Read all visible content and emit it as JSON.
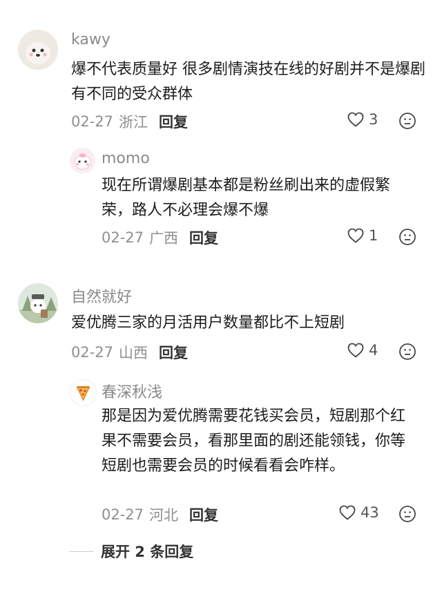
{
  "comments": [
    {
      "username": "kawy",
      "text": "爆不代表质量好 很多剧情演技在线的好剧并不是爆剧 有不同的受众群体",
      "date": "02-27",
      "location": "浙江",
      "reply_label": "回复",
      "likes": "3"
    },
    {
      "username": "momo",
      "text": "现在所谓爆剧基本都是粉丝刷出来的虚假繁荣，路人不必理会爆不爆",
      "date": "02-27",
      "location": "广西",
      "reply_label": "回复",
      "likes": "1"
    },
    {
      "username": "自然就好",
      "text": "爱优腾三家的月活用户数量都比不上短剧",
      "date": "02-27",
      "location": "山西",
      "reply_label": "回复",
      "likes": "4"
    },
    {
      "username": "春深秋浅",
      "text": "那是因为爱优腾需要花钱买会员，短剧那个红果不需要会员，看那里面的剧还能领钱，你等短剧也需要会员的时候看看会咋样。",
      "date": "02-27",
      "location": "河北",
      "reply_label": "回复",
      "likes": "43"
    }
  ],
  "expand_replies": "展开 2 条回复",
  "icons": {
    "like": "heart-outline-icon",
    "dislike": "unhappy-face-icon"
  }
}
